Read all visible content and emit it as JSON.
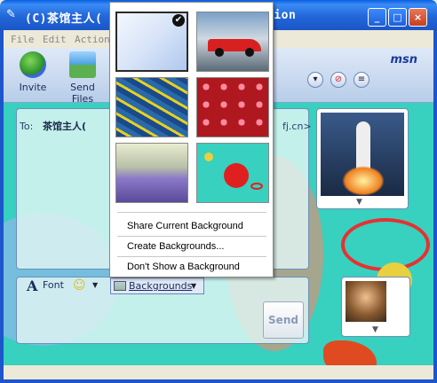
{
  "window": {
    "title": "(C)茶馆主人(",
    "title_tail": "tion",
    "buttons": [
      "_",
      "□",
      "×"
    ]
  },
  "menubar": {
    "items": [
      "File",
      "Edit",
      "Actions"
    ]
  },
  "toolbar": {
    "invite_label": "Invite",
    "send_files_label": "Send Files",
    "brand": "msn"
  },
  "conversation": {
    "to_label": "To:",
    "to_name": "茶馆主人(",
    "to_suffix": "fj.cn>"
  },
  "format_bar": {
    "font_label": "Font",
    "backgrounds_label": "Backgrounds"
  },
  "send_label": "Send",
  "backgrounds_menu": {
    "items": [
      {
        "label": "Share Current Background",
        "underline": "S"
      },
      {
        "label": "Create Backgrounds...",
        "underline": "B"
      },
      {
        "label": "Don't Show a Background",
        "underline": "D"
      }
    ],
    "thumbnails": [
      {
        "icon": "default-blue-background",
        "selected": true
      },
      {
        "icon": "race-car-background",
        "selected": false
      },
      {
        "icon": "fish-background",
        "selected": false
      },
      {
        "icon": "hearts-background",
        "selected": false
      },
      {
        "icon": "lavender-background",
        "selected": false
      },
      {
        "icon": "space-planets-background",
        "selected": false
      }
    ]
  },
  "colors": {
    "titlebar": "#2366d8",
    "background_teal": "#38d0bf",
    "panel_border": "#6d8fb8"
  }
}
